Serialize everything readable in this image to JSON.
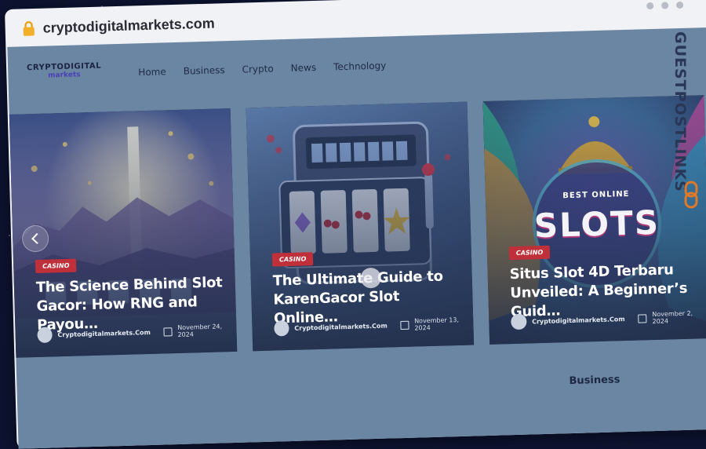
{
  "browser": {
    "url": "cryptodigitalmarkets.com",
    "lock_icon": "lock-icon"
  },
  "site": {
    "logo_top": "CRYPTODIGITAL",
    "logo_bottom": "markets",
    "nav": [
      "Home",
      "Business",
      "Crypto",
      "News",
      "Technology"
    ]
  },
  "cards": [
    {
      "category": "CASINO",
      "title": "The Science Behind Slot Gacor: How RNG and Payou…",
      "author": "Cryptodigitalmarkets.Com",
      "date": "November 24, 2024"
    },
    {
      "category": "CASINO",
      "title": "The Ultimate Guide to KarenGacor Slot Online…",
      "author": "Cryptodigitalmarkets.Com",
      "date": "November 13, 2024"
    },
    {
      "category": "CASINO",
      "title": "Situs Slot 4D Terbaru Unveiled: A Beginner’s Guid…",
      "author": "Cryptodigitalmarkets.Com",
      "date": "November 2, 2024"
    }
  ],
  "art": {
    "card3_top": "BEST ONLINE",
    "card3_big": "SLOTS"
  },
  "section": {
    "business_heading": "Business"
  },
  "watermark": {
    "text": "GUESTPOSTLINKS"
  },
  "colors": {
    "badge": "#c0303a",
    "overlay": "#6b86a3",
    "watermark": "#2a3656"
  }
}
